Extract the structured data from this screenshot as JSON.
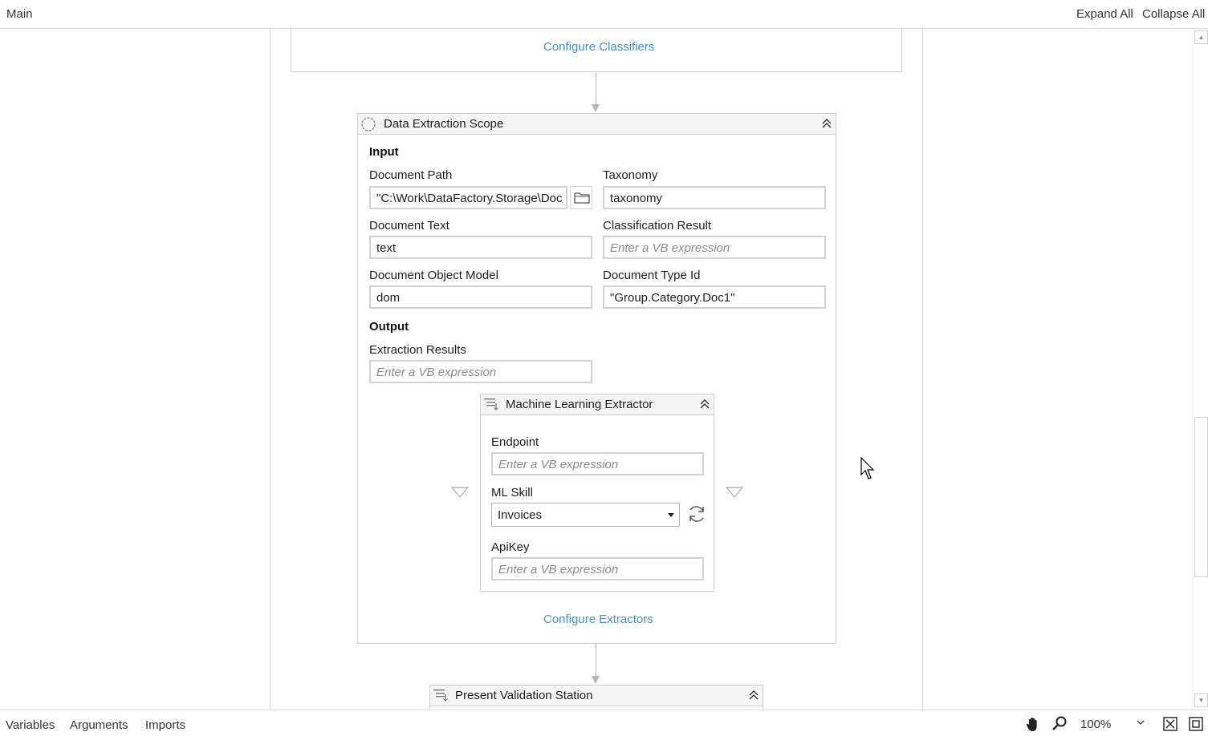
{
  "topbar": {
    "title": "Main",
    "expand_all": "Expand All",
    "collapse_all": "Collapse All"
  },
  "classifiers": {
    "configure_label": "Configure Classifiers"
  },
  "data_extraction_scope": {
    "title": "Data Extraction Scope",
    "input_label": "Input",
    "document_path": {
      "label": "Document Path",
      "value": "\"C:\\Work\\DataFactory.Storage\\Doc"
    },
    "taxonomy": {
      "label": "Taxonomy",
      "value": "taxonomy"
    },
    "document_text": {
      "label": "Document Text",
      "value": "text"
    },
    "classification_result": {
      "label": "Classification Result",
      "placeholder": "Enter a VB expression"
    },
    "document_object_model": {
      "label": "Document Object Model",
      "value": "dom"
    },
    "document_type_id": {
      "label": "Document Type Id",
      "value": "\"Group.Category.Doc1\""
    },
    "output_label": "Output",
    "extraction_results": {
      "label": "Extraction Results",
      "placeholder": "Enter a VB expression"
    },
    "configure_extractors_label": "Configure Extractors"
  },
  "ml_extractor": {
    "title": "Machine Learning Extractor",
    "endpoint": {
      "label": "Endpoint",
      "placeholder": "Enter a VB expression"
    },
    "ml_skill": {
      "label": "ML Skill",
      "value": "Invoices"
    },
    "apikey": {
      "label": "ApiKey",
      "placeholder": "Enter a VB expression"
    }
  },
  "validation_station": {
    "title": "Present Validation Station"
  },
  "bottombar": {
    "variables": "Variables",
    "arguments": "Arguments",
    "imports": "Imports",
    "zoom": "100%"
  },
  "icons": [
    "scope-icon",
    "collapse-chevron-icon",
    "folder-icon",
    "refresh-icon",
    "hand-icon",
    "zoom-icon",
    "fit-to-screen-icon",
    "overview-icon",
    "dropdown-arrow-icon",
    "activity-icon"
  ],
  "colors": {
    "link": "#4a8fc8",
    "border": "#cfcfcf",
    "header_bg": "#f5f5f5"
  }
}
